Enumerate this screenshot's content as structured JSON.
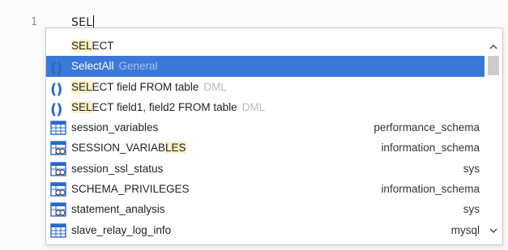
{
  "editor": {
    "line_number": "1",
    "code": "SEL"
  },
  "popup": {
    "items": [
      {
        "prefix": "SEL",
        "rest": "ECT",
        "hint": "",
        "right": "",
        "icon": "none"
      },
      {
        "prefix": "Sel",
        "rest": "ectAll",
        "hint": "General",
        "right": "",
        "icon": "parentheses-icon",
        "selected": true
      },
      {
        "prefix": "SEL",
        "rest": "ECT field FROM table",
        "hint": "DML",
        "right": "",
        "icon": "parentheses-icon"
      },
      {
        "prefix": "SEL",
        "rest": "ECT field1, field2 FROM table",
        "hint": "DML",
        "right": "",
        "icon": "parentheses-icon"
      },
      {
        "prefix": "",
        "rest": "session_variables",
        "hint": "",
        "right": "performance_schema",
        "icon": "table-icon"
      },
      {
        "prefix": "",
        "rest": "SESSION_VARIABLES",
        "hint": "",
        "right": "information_schema",
        "icon": "view-icon",
        "hl_mid": "LES"
      },
      {
        "prefix": "",
        "rest": "session_ssl_status",
        "hint": "",
        "right": "sys",
        "icon": "view-icon"
      },
      {
        "prefix": "",
        "rest": "SCHEMA_PRIVILEGES",
        "hint": "",
        "right": "information_schema",
        "icon": "view-icon"
      },
      {
        "prefix": "",
        "rest": "statement_analysis",
        "hint": "",
        "right": "sys",
        "icon": "view-icon"
      },
      {
        "prefix": "",
        "rest": "slave_relay_log_info",
        "hint": "",
        "right": "mysql",
        "icon": "table-icon"
      }
    ]
  },
  "scrollbar": {
    "up_glyph": "^",
    "down_glyph": "v"
  },
  "colors": {
    "selection": "#3b78d8",
    "highlight": "#fbf1c5",
    "icon_blue": "#2b67c7"
  }
}
